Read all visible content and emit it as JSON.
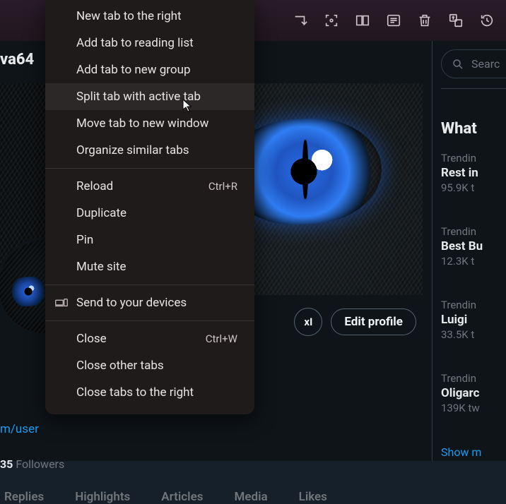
{
  "browser_chrome": {
    "toolbar_icons": [
      "cast-icon",
      "scan-icon",
      "reader-icon",
      "sidepanel-icon",
      "delete-icon",
      "translate-icon",
      "history-icon"
    ]
  },
  "profile": {
    "display_name_fragment": "va64",
    "link_fragment": "m/user",
    "followers_count": "35",
    "followers_label": "Followers"
  },
  "profile_actions": {
    "ai_label": "xI",
    "edit_label": "Edit profile"
  },
  "tabs": [
    "Replies",
    "Highlights",
    "Articles",
    "Media",
    "Likes"
  ],
  "right_sidebar": {
    "search_placeholder": "Searc",
    "section_title": "What",
    "trends": [
      {
        "category": "Trendin",
        "topic": "Rest in",
        "count": "95.9K t"
      },
      {
        "category": "Trendin",
        "topic": "Best Bu",
        "count": "12.3K t"
      },
      {
        "category": "Trendin",
        "topic": "Luigi",
        "count": "33.5K t"
      },
      {
        "category": "Trendin",
        "topic": "Oligarc",
        "count": "139K tw"
      }
    ],
    "show_more": "Show m"
  },
  "context_menu": {
    "group1": [
      {
        "label": "New tab to the right"
      },
      {
        "label": "Add tab to reading list"
      },
      {
        "label": "Add tab to new group"
      },
      {
        "label": "Split tab with active tab",
        "hover": true
      },
      {
        "label": "Move tab to new window"
      },
      {
        "label": "Organize similar tabs"
      }
    ],
    "group2": [
      {
        "label": "Reload",
        "shortcut": "Ctrl+R"
      },
      {
        "label": "Duplicate"
      },
      {
        "label": "Pin"
      },
      {
        "label": "Mute site"
      }
    ],
    "group3": [
      {
        "label": "Send to your devices",
        "icon": true
      }
    ],
    "group4": [
      {
        "label": "Close",
        "shortcut": "Ctrl+W"
      },
      {
        "label": "Close other tabs"
      },
      {
        "label": "Close tabs to the right"
      }
    ]
  }
}
